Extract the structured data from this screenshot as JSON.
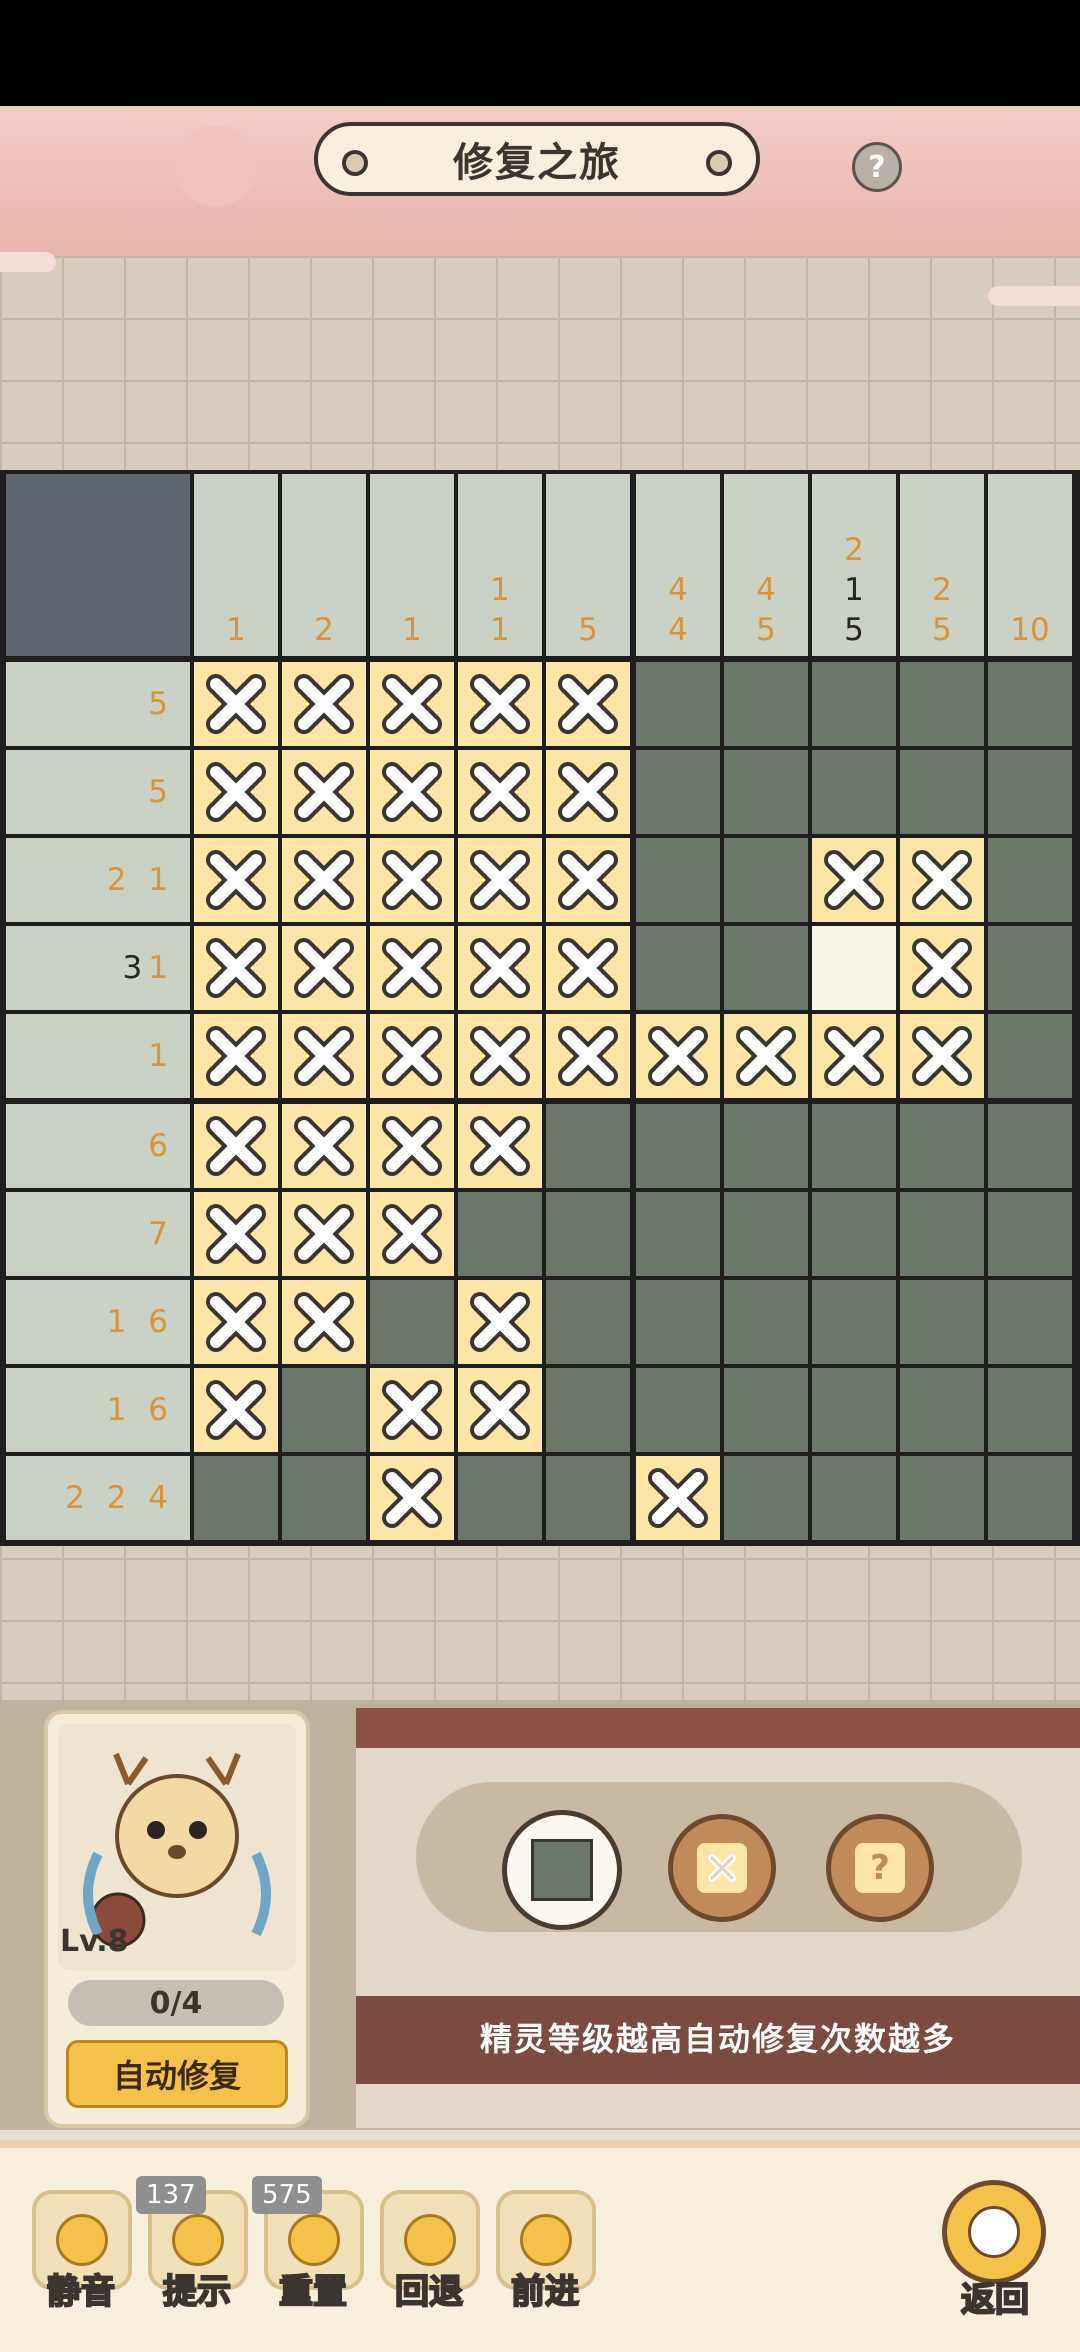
{
  "header": {
    "title": "修复之旅",
    "help_label": "?"
  },
  "col_clues": [
    [
      "1"
    ],
    [
      "2"
    ],
    [
      "1"
    ],
    [
      "1",
      "1"
    ],
    [
      "5"
    ],
    [
      "4",
      "4"
    ],
    [
      "4",
      "5"
    ],
    [
      "2",
      "1",
      "5"
    ],
    [
      "2",
      "5"
    ],
    [
      "10"
    ]
  ],
  "col_clue_dark": [
    [],
    [],
    [],
    [],
    [],
    [],
    [],
    [
      1,
      2
    ],
    [],
    []
  ],
  "row_clues": [
    "5",
    "5",
    "2 1",
    "3 1",
    "1",
    "6",
    "7",
    "1 6",
    "1 6",
    "2 2 4"
  ],
  "row_clue_dark_first": [
    false,
    false,
    false,
    true,
    false,
    false,
    false,
    false,
    false,
    false
  ],
  "grid": [
    "xxxxxfffff",
    "xxxxxfffff",
    "xxxxxffxxf",
    "xxxxxffexf",
    "xxxxxxxxxf",
    "xxxxffffff",
    "xxxfffffff",
    "xxfxffffff",
    "xfxxffffff",
    "ffxffxffff"
  ],
  "colors": {
    "filled": "#6b7768",
    "crossed": "#fbe6a8",
    "empty": "#f8f6ea",
    "clue": "#d9933a"
  },
  "sprite": {
    "level": "Lv.8",
    "counter": "0/4",
    "auto_label": "自动修复"
  },
  "modes": {
    "fill_icon": "filled-square-icon",
    "cross_icon": "x-icon",
    "unknown_label": "?"
  },
  "hint_text": "精灵等级越高自动修复次数越多",
  "bottom": {
    "mute_label": "静音",
    "hint_label": "提示",
    "hint_badge": "137",
    "reset_label": "重置",
    "reset_badge": "575",
    "undo_label": "回退",
    "redo_label": "前进",
    "back_label": "返回"
  }
}
